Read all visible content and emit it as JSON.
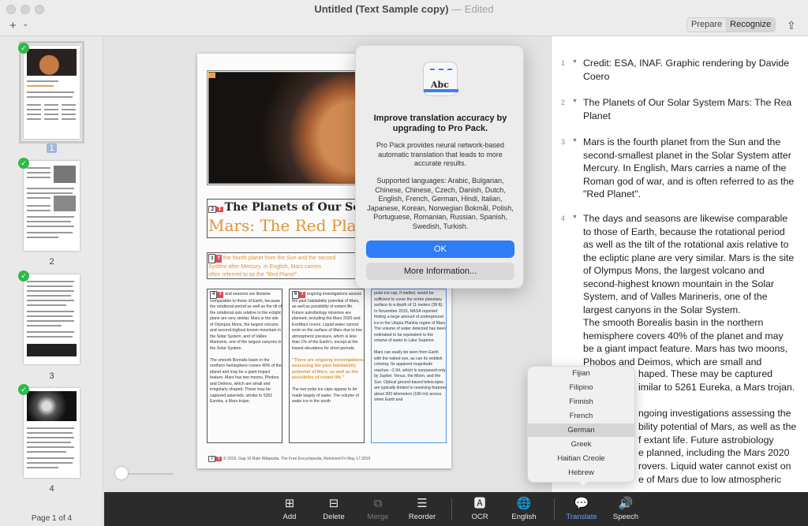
{
  "window": {
    "title": "Untitled (Text Sample copy)",
    "edited": "— Edited",
    "seg_prepare": "Prepare",
    "seg_recognize": "Recognize",
    "add_icon": "+",
    "chevron": "⌄",
    "share_icon": "⇪"
  },
  "sidebar": {
    "pages": [
      "1",
      "2",
      "3",
      "4"
    ],
    "check": "✓",
    "page_of": "Page 1 of 4"
  },
  "document": {
    "title": "The Planets of Our Solar Sy",
    "subtitle": "Mars: The Red Pla",
    "intro_line1": "the fourth planet from the Sun and the second",
    "intro_line2": "System after Mercury. In English, Mars carries",
    "intro_line3": "often referred to as the \"Red Planet\".",
    "col1": "and seasons are likewise comparable to those of Earth, because the rotational period as well as the tilt of the rotational axis relative to the ecliptic plane are very similar. Mars is the site of Olympus Mons, the largest volcano and second-highest known mountain in the Solar System, and of Valles Marineris, one of the largest canyons in the Solar System.",
    "col1b": "The smooth Borealis basin in the northern hemisphere covers 40% of the planet and may be a giant impact feature. Mars has two moons, Phobos and Deimos, which are small and irregularly shaped. These may be captured asteroids, similar to 5261 Eureka, a Mars trojan.",
    "col2": "ongoing investigations assess the past habitability potential of Mars, as well as possibility of extant life. Future astrobiology missions are planned, including the Mars 2020 and ExoMars rovers. Liquid water cannot exist on the surface of Mars due to low atmospheric pressure, which is less than 1% of the Earth's, except at the lowest elevations for short periods.",
    "col2q": "\"There are ongoing investigations assessing the past habitability potential of Mars, as well as the possibility of extant life.\"",
    "col2b": "The two polar ice caps appear to be made largely of water. The volume of water ice in the south",
    "col3": "polar ice cap, if melted, would be sufficient to cover the entire planetary surface to a depth of 11 meters (36 ft). In November 2016, NASA reported finding a large amount of underground ice in the Utopia Planitia region of Mars. The volume of water detected has been estimated to be equivalent to the volume of water in Lake Superior.",
    "col3b": "Mars can easily be seen from Earth with the naked eye, as can its reddish coloring. Its apparent magnitude reaches −2.94, which is surpassed only by Jupiter, Venus, the Moon, and the Sun. Optical ground-based telescopes are typically limited to resolving features about 300 kilometers (190 mi) across when Earth and",
    "footer": "© 2019, Gap 10 Rate Wikipedia, The Free Encyclopedia, Retrieved Fri May 17 2019",
    "tag": "T",
    "n2": "2",
    "n3": "3",
    "n4": "4",
    "n6": "6",
    "n7": "7"
  },
  "popover": {
    "icon_text": "Abc",
    "title": "Improve translation accuracy by upgrading to Pro Pack.",
    "body": "Pro Pack provides neural network-based automatic translation that leads to more accurate results.",
    "languages": "Supported languages: Arabic, Bulgarian, Chinese, Chinese, Czech, Danish, Dutch, English, French, German, Hindi, Italian, Japanese, Korean, Norwegian Bokmål, Polish, Portuguese, Romanian, Russian, Spanish, Swedish, Turkish.",
    "ok": "OK",
    "more": "More Information..."
  },
  "panel": {
    "paragraphs": [
      {
        "n": "1",
        "text": "Credit: ESA, INAF. Graphic rendering by Davide Coero"
      },
      {
        "n": "2",
        "text": "The Planets of Our Solar System Mars: The Rea Planet"
      },
      {
        "n": "3",
        "text": "Mars is the fourth planet from the Sun and the second-smallest planet in the Solar System atter Mercury. In English, Mars carries a name of the Roman god of war, and is often referred to as the \"Red Planet\"."
      },
      {
        "n": "4",
        "text": "The days and seasons are likewise comparable to those of Earth, because the rotational period as well as the tilt of the rotational axis relative to the ecliptic plane are very similar. Mars is the site of Olympus Mons, the largest volcano and second-highest known mountain in the Solar System, and of Valles Marineris, one of the largest canyons in the Solar System."
      }
    ],
    "p4b": "The smooth Borealis basin in the northern hemisphere covers 40% of the planet and may be a giant impact feature. Mars has two moons, Phobos and Deimos, which are small and",
    "p4c": "haped. These may be captured",
    "p4d": "imilar to 5261 Eureka, a Mars trojan.",
    "p5a": "ngoing investigations assessing the",
    "p5b": "bility potential of Mars, as well as the",
    "p5c": "f extant life. Future astrobiology",
    "p5d": "e planned, including the Mars 2020",
    "p5e": "rovers. Liquid water cannot exist on",
    "p5f": "e of Mars due to low atmospheric"
  },
  "language_menu": {
    "items": [
      "Fijian",
      "Filipino",
      "Finnish",
      "French",
      "German",
      "Greek",
      "Haitian Creole",
      "Hebrew"
    ],
    "selected": "German"
  },
  "toolbar": {
    "items": [
      {
        "label": "Add",
        "icon": "⊞"
      },
      {
        "label": "Delete",
        "icon": "⊟"
      },
      {
        "label": "Merge",
        "icon": "⧉"
      },
      {
        "label": "Reorder",
        "icon": "☰"
      },
      {
        "label": "OCR",
        "icon": "🅰"
      },
      {
        "label": "English",
        "icon": "🌐"
      },
      {
        "label": "Translate",
        "icon": "💬"
      },
      {
        "label": "Speech",
        "icon": "🔊"
      }
    ]
  },
  "colors": {
    "accent": "#2f7cf6",
    "orange": "#e0953a",
    "check_green": "#2fb94a",
    "tag_red": "#e04a55",
    "toolbar_bg": "#2b2b2b",
    "active_tool": "#5aa2ff"
  }
}
